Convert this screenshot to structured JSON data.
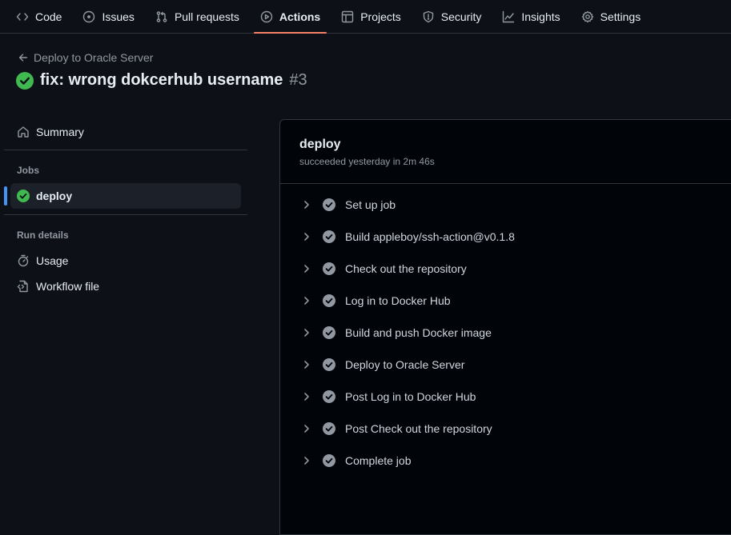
{
  "nav": {
    "tabs": [
      {
        "label": "Code",
        "icon": "code-icon"
      },
      {
        "label": "Issues",
        "icon": "issue-icon"
      },
      {
        "label": "Pull requests",
        "icon": "pull-request-icon"
      },
      {
        "label": "Actions",
        "icon": "play-icon",
        "active": true
      },
      {
        "label": "Projects",
        "icon": "table-icon"
      },
      {
        "label": "Security",
        "icon": "shield-icon"
      },
      {
        "label": "Insights",
        "icon": "graph-icon"
      },
      {
        "label": "Settings",
        "icon": "gear-icon"
      }
    ]
  },
  "header": {
    "back_label": "Deploy to Oracle Server",
    "run_title": "fix: wrong dokcerhub username",
    "run_number": "#3"
  },
  "sidebar": {
    "summary_label": "Summary",
    "jobs_heading": "Jobs",
    "job_label": "deploy",
    "run_details_heading": "Run details",
    "usage_label": "Usage",
    "workflow_file_label": "Workflow file"
  },
  "job": {
    "name": "deploy",
    "status": "succeeded yesterday in 2m 46s",
    "steps": [
      "Set up job",
      "Build appleboy/ssh-action@v0.1.8",
      "Check out the repository",
      "Log in to Docker Hub",
      "Build and push Docker image",
      "Deploy to Oracle Server",
      "Post Log in to Docker Hub",
      "Post Check out the repository",
      "Complete job"
    ]
  },
  "colors": {
    "background": "#0d1117",
    "panel": "#010409",
    "success": "#3fb950",
    "step_check": "#9198a1",
    "active_tab_underline": "#f78166",
    "selected_indicator": "#4493f8"
  }
}
